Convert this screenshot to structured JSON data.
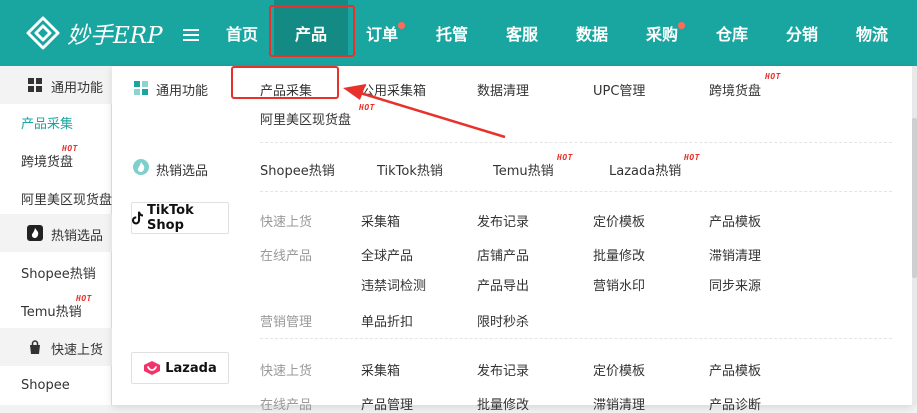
{
  "logo": {
    "text": "妙手ERP"
  },
  "nav": [
    {
      "label": "首页"
    },
    {
      "label": "产品"
    },
    {
      "label": "订单"
    },
    {
      "label": "托管"
    },
    {
      "label": "客服"
    },
    {
      "label": "数据"
    },
    {
      "label": "采购"
    },
    {
      "label": "仓库"
    },
    {
      "label": "分销"
    },
    {
      "label": "物流"
    }
  ],
  "sidebar": {
    "items": [
      {
        "label": "通用功能",
        "type": "group",
        "icon": "grid-icon"
      },
      {
        "label": "产品采集",
        "type": "link",
        "active": true
      },
      {
        "label": "跨境货盘",
        "type": "link",
        "hot": true
      },
      {
        "label": "阿里美区现货盘",
        "type": "link"
      },
      {
        "label": "热销选品",
        "type": "group",
        "icon": "flame-icon"
      },
      {
        "label": "Shopee热销",
        "type": "link"
      },
      {
        "label": "Temu热销",
        "type": "link",
        "hot": true
      },
      {
        "label": "快速上货",
        "type": "group",
        "icon": "bag-icon"
      },
      {
        "label": "Shopee",
        "type": "link"
      }
    ]
  },
  "hot_badge": "HOT",
  "menu": {
    "general": {
      "title": "通用功能",
      "items": [
        "产品采集",
        "公用采集箱",
        "数据清理",
        "UPC管理",
        "跨境货盘",
        "阿里美区现货盘"
      ]
    },
    "hot_sales": {
      "title": "热销选品",
      "items": [
        "Shopee热销",
        "TikTok热销",
        "Temu热销",
        "Lazada热销"
      ]
    },
    "tiktok": {
      "brand": "TikTok Shop",
      "rows": [
        {
          "label": "快速上货",
          "items": [
            "采集箱",
            "发布记录",
            "定价模板",
            "产品模板"
          ]
        },
        {
          "label": "在线产品",
          "items": [
            "全球产品",
            "店铺产品",
            "批量修改",
            "滞销清理"
          ]
        },
        {
          "label": "",
          "items": [
            "违禁词检测",
            "产品导出",
            "营销水印",
            "同步来源"
          ]
        },
        {
          "label": "营销管理",
          "items": [
            "单品折扣",
            "限时秒杀"
          ]
        }
      ]
    },
    "lazada": {
      "brand": "Lazada",
      "rows": [
        {
          "label": "快速上货",
          "items": [
            "采集箱",
            "发布记录",
            "定价模板",
            "产品模板"
          ]
        },
        {
          "label": "在线产品",
          "items": [
            "产品管理",
            "批量修改",
            "滞销清理",
            "产品诊断"
          ]
        }
      ]
    }
  },
  "colors": {
    "brand": "#1aa6a0",
    "brand_dark": "#148a85",
    "highlight": "#e8312a",
    "lazada": "#f2326b"
  }
}
